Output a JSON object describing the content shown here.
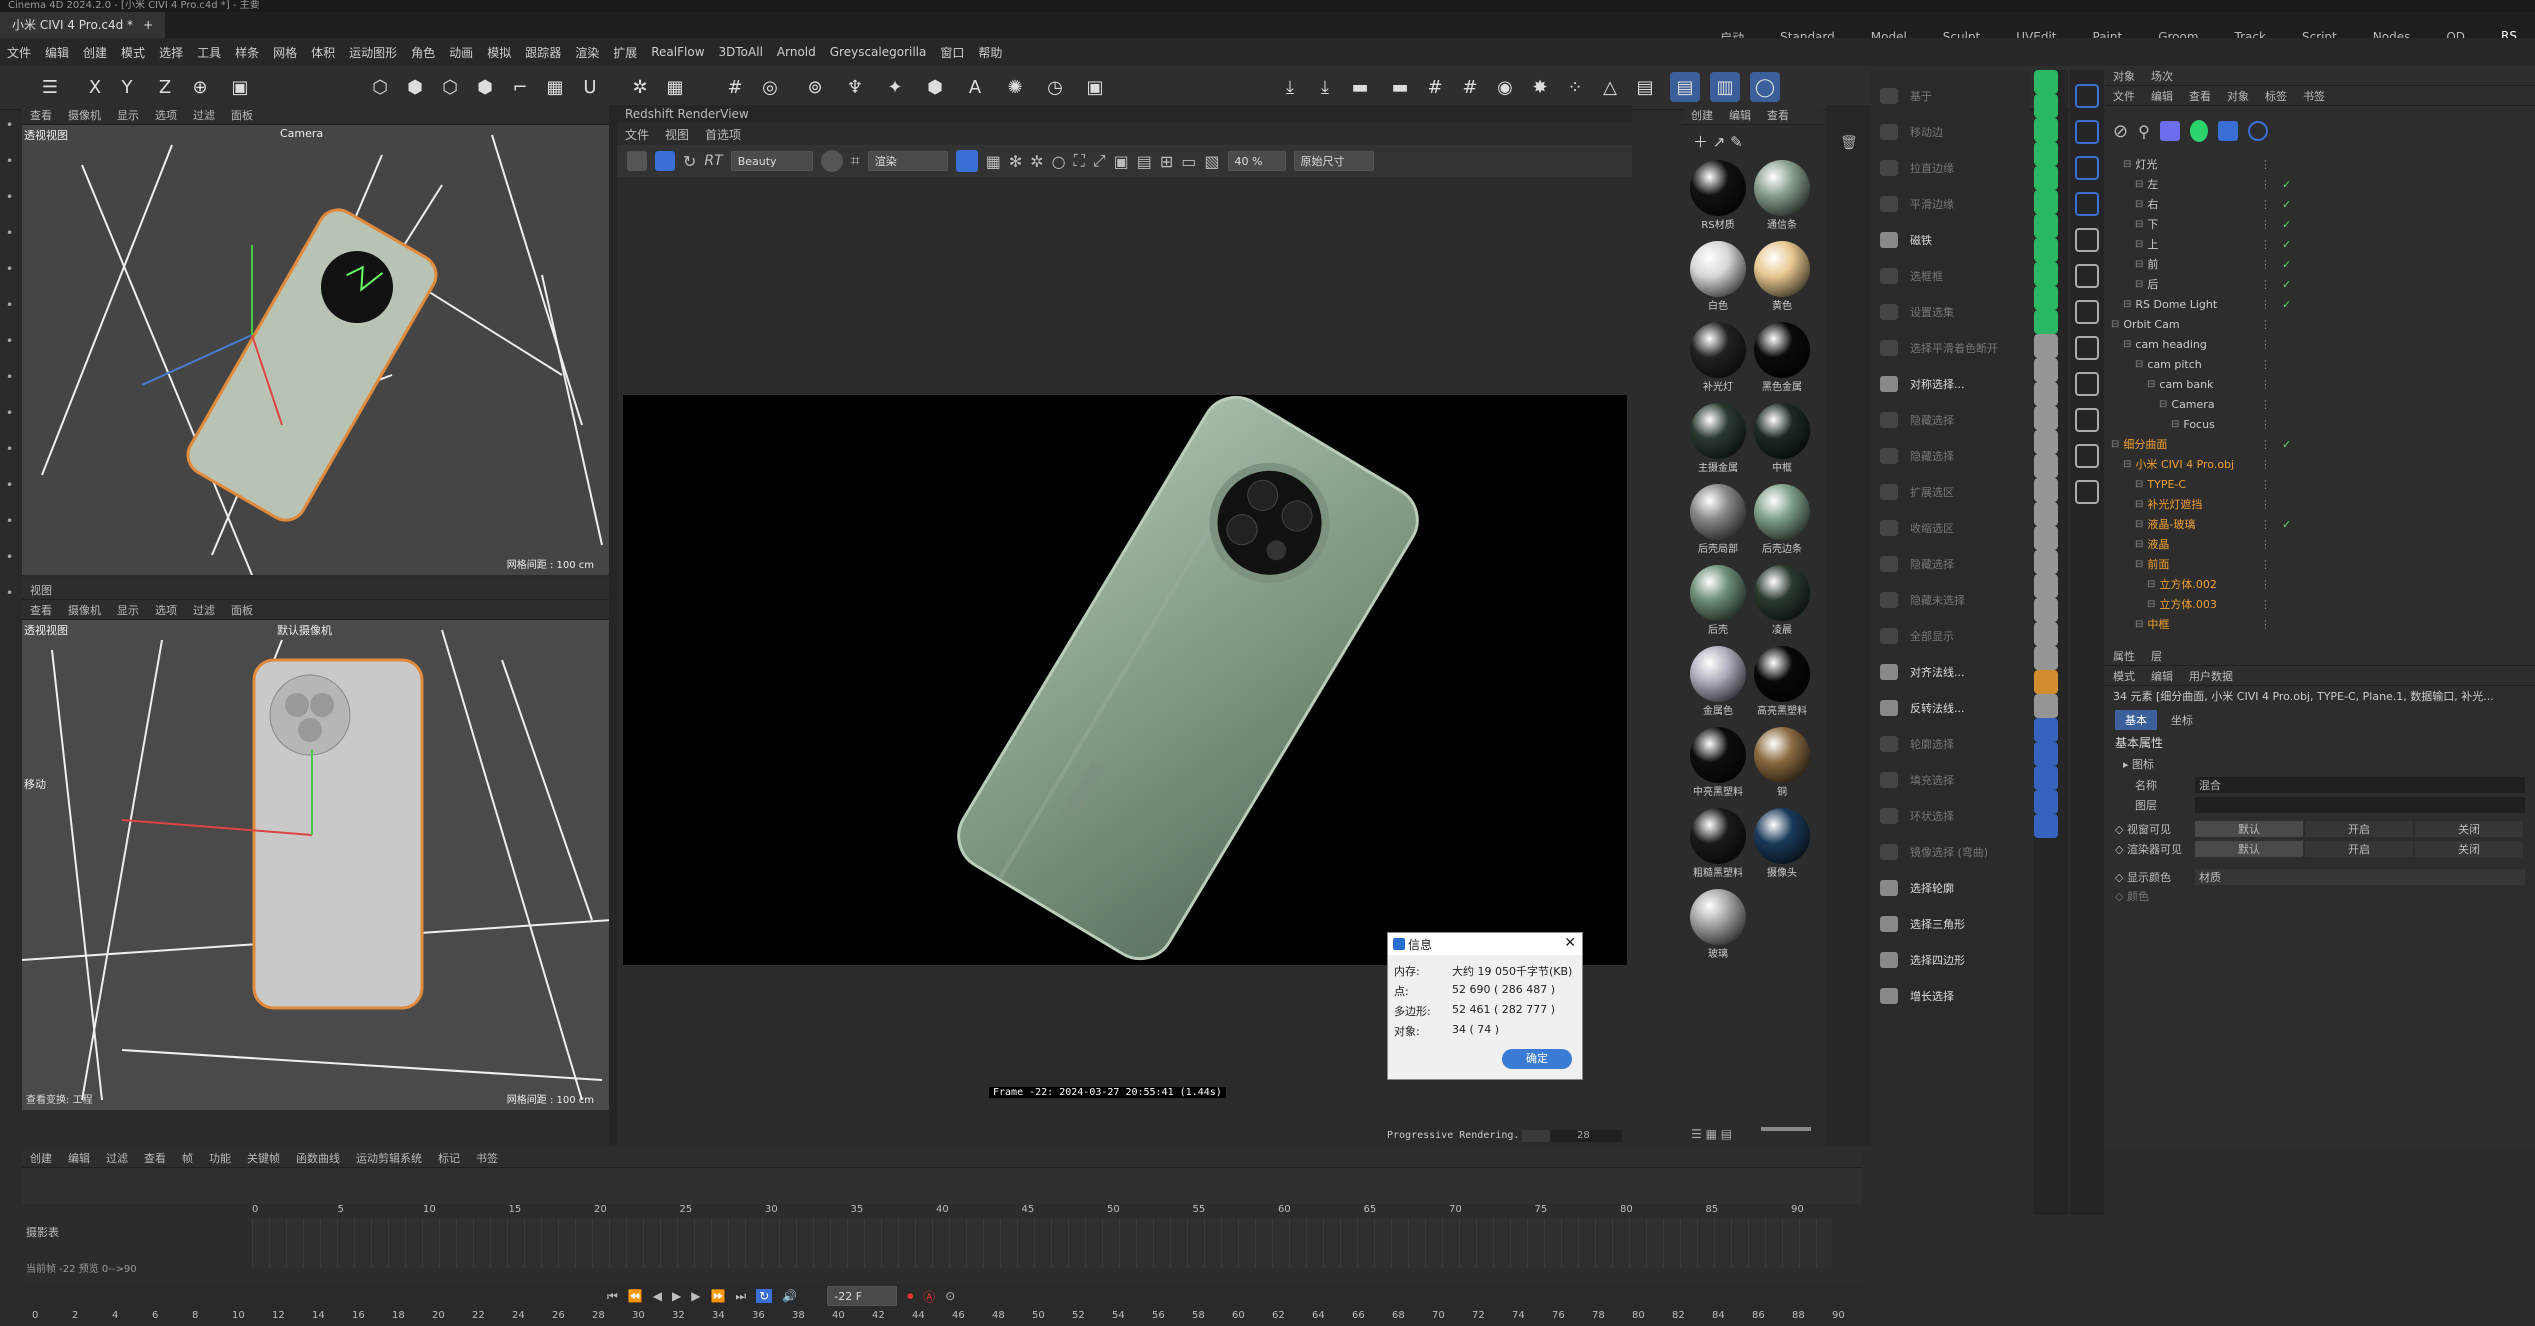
{
  "window": {
    "title": "Cinema 4D 2024.2.0 - [小米 CIVI 4 Pro.c4d *] - 主要"
  },
  "tabs": [
    {
      "label": "小米 CIVI 4 Pro.c4d *",
      "close": "×"
    },
    {
      "label": "+"
    }
  ],
  "layouts": [
    "启动",
    "Standard",
    "Model",
    "Sculpt",
    "UVEdit",
    "Paint",
    "Groom",
    "Track",
    "Script",
    "Nodes",
    "QD",
    "RS"
  ],
  "active_layout": "RS",
  "menu": [
    "文件",
    "编辑",
    "创建",
    "模式",
    "选择",
    "工具",
    "样条",
    "网格",
    "体积",
    "运动图形",
    "角色",
    "动画",
    "模拟",
    "跟踪器",
    "渲染",
    "扩展",
    "RealFlow",
    "3DToAll",
    "Arnold",
    "Greyscalegorilla",
    "窗口",
    "帮助"
  ],
  "viewport_top": {
    "menu": [
      "查看",
      "摄像机",
      "显示",
      "选项",
      "过滤",
      "面板"
    ],
    "name": "透视视图",
    "camera": "Camera",
    "grid_info": "网格间距 : 100 cm"
  },
  "viewport_bottom": {
    "title": "视图",
    "menu": [
      "查看",
      "摄像机",
      "显示",
      "选项",
      "过滤",
      "面板"
    ],
    "name": "透视视图",
    "camera": "默认摄像机",
    "move_label": "移动",
    "footer_left": "查看变换: 工程",
    "grid_info": "网格间距 : 100 cm"
  },
  "renderview": {
    "title": "Redshift RenderView",
    "menu": [
      "文件",
      "视图",
      "首选项"
    ],
    "aov": "Beauty",
    "channel": "渲染",
    "zoom": "40 %",
    "size": "原始尺寸",
    "stamp": "Frame -22:  2024-03-27  20:55:41  (1.44s)",
    "progress": "Progressive Rendering...",
    "progress_value": "28"
  },
  "materials": {
    "menu": [
      "创建",
      "编辑",
      "查看"
    ],
    "items": [
      {
        "name": "RS材质",
        "color": "#111"
      },
      {
        "name": "通信条",
        "color": "#8aa08f"
      },
      {
        "name": "白色",
        "color": "#d8d8d8"
      },
      {
        "name": "黄色",
        "color": "#e8c890"
      },
      {
        "name": "补光灯",
        "color": "#222"
      },
      {
        "name": "黑色金属",
        "color": "#0a0a0a"
      },
      {
        "name": "主摄金属",
        "color": "#2a3a30"
      },
      {
        "name": "中框",
        "color": "#1c2a22"
      },
      {
        "name": "后壳局部",
        "color": "#888"
      },
      {
        "name": "后壳边条",
        "color": "#7fa08a"
      },
      {
        "name": "后壳",
        "color": "#6d8f78"
      },
      {
        "name": "凌晨",
        "color": "#2a3a2f"
      },
      {
        "name": "金属色",
        "color": "#b0b0c0"
      },
      {
        "name": "高亮黑塑料",
        "color": "#080808"
      },
      {
        "name": "中亮黑塑料",
        "color": "#0d0d0d"
      },
      {
        "name": "铜",
        "color": "#8a6a40"
      },
      {
        "name": "粗糙黑塑料",
        "color": "#1a1a1a"
      },
      {
        "name": "摄像头",
        "color": "#1a3a5a"
      },
      {
        "name": "玻璃",
        "color": "#a8a8a8"
      }
    ]
  },
  "commands": [
    {
      "label": "基于",
      "on": false
    },
    {
      "label": "移动边",
      "on": false
    },
    {
      "label": "拉直边缘",
      "on": false
    },
    {
      "label": "平滑边缘",
      "on": false
    },
    {
      "label": "磁铁",
      "on": true
    },
    {
      "label": "选框框",
      "on": false
    },
    {
      "label": "设置选集",
      "on": false
    },
    {
      "label": "选择平滑着色断开",
      "on": false
    },
    {
      "label": "对称选择...",
      "on": true
    },
    {
      "label": "隐藏选择",
      "on": false
    },
    {
      "label": "隐藏选择",
      "on": false
    },
    {
      "label": "扩展选区",
      "on": false
    },
    {
      "label": "收缩选区",
      "on": false
    },
    {
      "label": "隐藏选择",
      "on": false
    },
    {
      "label": "隐藏未选择",
      "on": false
    },
    {
      "label": "全部显示",
      "on": false
    },
    {
      "label": "对齐法线...",
      "on": true
    },
    {
      "label": "反转法线...",
      "on": true
    },
    {
      "label": "轮廓选择",
      "on": false
    },
    {
      "label": "填充选择",
      "on": false
    },
    {
      "label": "环状选择",
      "on": false
    },
    {
      "label": "镜像选择 (弯曲)",
      "on": false
    },
    {
      "label": "选择轮廓",
      "on": true
    },
    {
      "label": "选择三角形",
      "on": true
    },
    {
      "label": "选择四边形",
      "on": true
    },
    {
      "label": "增长选择",
      "on": true
    }
  ],
  "objects": {
    "tabs": [
      "对象",
      "场次"
    ],
    "menu": [
      "文件",
      "编辑",
      "查看",
      "对象",
      "标签",
      "书签"
    ],
    "rows": [
      {
        "name": "灯光",
        "indent": 1,
        "check": false,
        "color": "#ccc"
      },
      {
        "name": "左",
        "indent": 2,
        "check": true,
        "color": "#ccc"
      },
      {
        "name": "右",
        "indent": 2,
        "check": true,
        "color": "#ccc"
      },
      {
        "name": "下",
        "indent": 2,
        "check": true,
        "color": "#ccc"
      },
      {
        "name": "上",
        "indent": 2,
        "check": true,
        "color": "#ccc"
      },
      {
        "name": "前",
        "indent": 2,
        "check": true,
        "color": "#ccc"
      },
      {
        "name": "后",
        "indent": 2,
        "check": true,
        "color": "#ccc"
      },
      {
        "name": "RS Dome Light",
        "indent": 1,
        "check": true,
        "color": "#ccc"
      },
      {
        "name": "Orbit Cam",
        "indent": 0,
        "check": false,
        "color": "#ccc"
      },
      {
        "name": "cam heading",
        "indent": 1,
        "check": false,
        "color": "#ccc"
      },
      {
        "name": "cam pitch",
        "indent": 2,
        "check": false,
        "color": "#ccc"
      },
      {
        "name": "cam bank",
        "indent": 3,
        "check": false,
        "color": "#ccc"
      },
      {
        "name": "Camera",
        "indent": 4,
        "check": false,
        "color": "#ccc"
      },
      {
        "name": "Focus",
        "indent": 5,
        "check": false,
        "color": "#ccc"
      },
      {
        "name": "细分曲面",
        "indent": 0,
        "check": true,
        "color": "#f0a030"
      },
      {
        "name": "小米 CIVI 4 Pro.obj",
        "indent": 1,
        "check": false,
        "color": "#f0a030"
      },
      {
        "name": "TYPE-C",
        "indent": 2,
        "check": false,
        "color": "#f0a030"
      },
      {
        "name": "补光灯遮挡",
        "indent": 2,
        "check": false,
        "color": "#f0a030"
      },
      {
        "name": "液晶-玻璃",
        "indent": 2,
        "check": true,
        "color": "#f0a030"
      },
      {
        "name": "液晶",
        "indent": 2,
        "check": false,
        "color": "#f0a030"
      },
      {
        "name": "前面",
        "indent": 2,
        "check": false,
        "color": "#f0a030"
      },
      {
        "name": "立方体.002",
        "indent": 3,
        "check": false,
        "color": "#f0a030"
      },
      {
        "name": "立方体.003",
        "indent": 3,
        "check": false,
        "color": "#f0a030"
      },
      {
        "name": "中框",
        "indent": 2,
        "check": false,
        "color": "#f0a030"
      }
    ]
  },
  "attributes": {
    "tabs": [
      "属性",
      "层"
    ],
    "menu": [
      "模式",
      "编辑",
      "用户数据"
    ],
    "summary": "34 元素 [细分曲面, 小米 CIVI 4 Pro.obj, TYPE-C, Plane.1, 数据输口, 补光...",
    "subtabs": [
      "基本",
      "坐标"
    ],
    "section": "基本属性",
    "group": "图标",
    "fields": [
      {
        "label": "名称",
        "value": "混合"
      },
      {
        "label": "图层",
        "value": ""
      }
    ],
    "vis": [
      {
        "label": "视窗可见",
        "opts": [
          "默认",
          "开启",
          "关闭"
        ]
      },
      {
        "label": "渲染器可见",
        "opts": [
          "默认",
          "开启",
          "关闭"
        ]
      }
    ],
    "display_color": {
      "label": "显示颜色",
      "value": "材质"
    },
    "color_label": "颜色"
  },
  "timeline": {
    "menu": [
      "创建",
      "编辑",
      "过滤",
      "查看",
      "帧",
      "功能",
      "关键帧",
      "函数曲线",
      "运动剪辑系统",
      "标记",
      "书签"
    ],
    "track_label": "摄影表",
    "ruler_top": [
      "0",
      "5",
      "10",
      "15",
      "20",
      "25",
      "30",
      "35",
      "40",
      "45",
      "50",
      "55",
      "60",
      "65",
      "70",
      "75",
      "80",
      "85",
      "90"
    ],
    "status": "当前帧 -22  预览 0-->90",
    "current_frame": "-22 F",
    "ruler_bottom": [
      "0",
      "2",
      "4",
      "6",
      "8",
      "10",
      "12",
      "14",
      "16",
      "18",
      "20",
      "22",
      "24",
      "26",
      "28",
      "30",
      "32",
      "34",
      "36",
      "38",
      "40",
      "42",
      "44",
      "46",
      "48",
      "50",
      "52",
      "54",
      "56",
      "58",
      "60",
      "62",
      "64",
      "66",
      "68",
      "70",
      "72",
      "74",
      "76",
      "78",
      "80",
      "82",
      "84",
      "86",
      "88",
      "90"
    ]
  },
  "dialog": {
    "title": "信息",
    "rows": [
      {
        "k": "内存:",
        "v": "大约 19 050千字节(KB)"
      },
      {
        "k": "点:",
        "v": "52 690 ( 286 487 )"
      },
      {
        "k": "多边形:",
        "v": "52 461 ( 282 777 )"
      },
      {
        "k": "对象:",
        "v": "34 ( 74 )"
      }
    ],
    "ok": "确定"
  }
}
